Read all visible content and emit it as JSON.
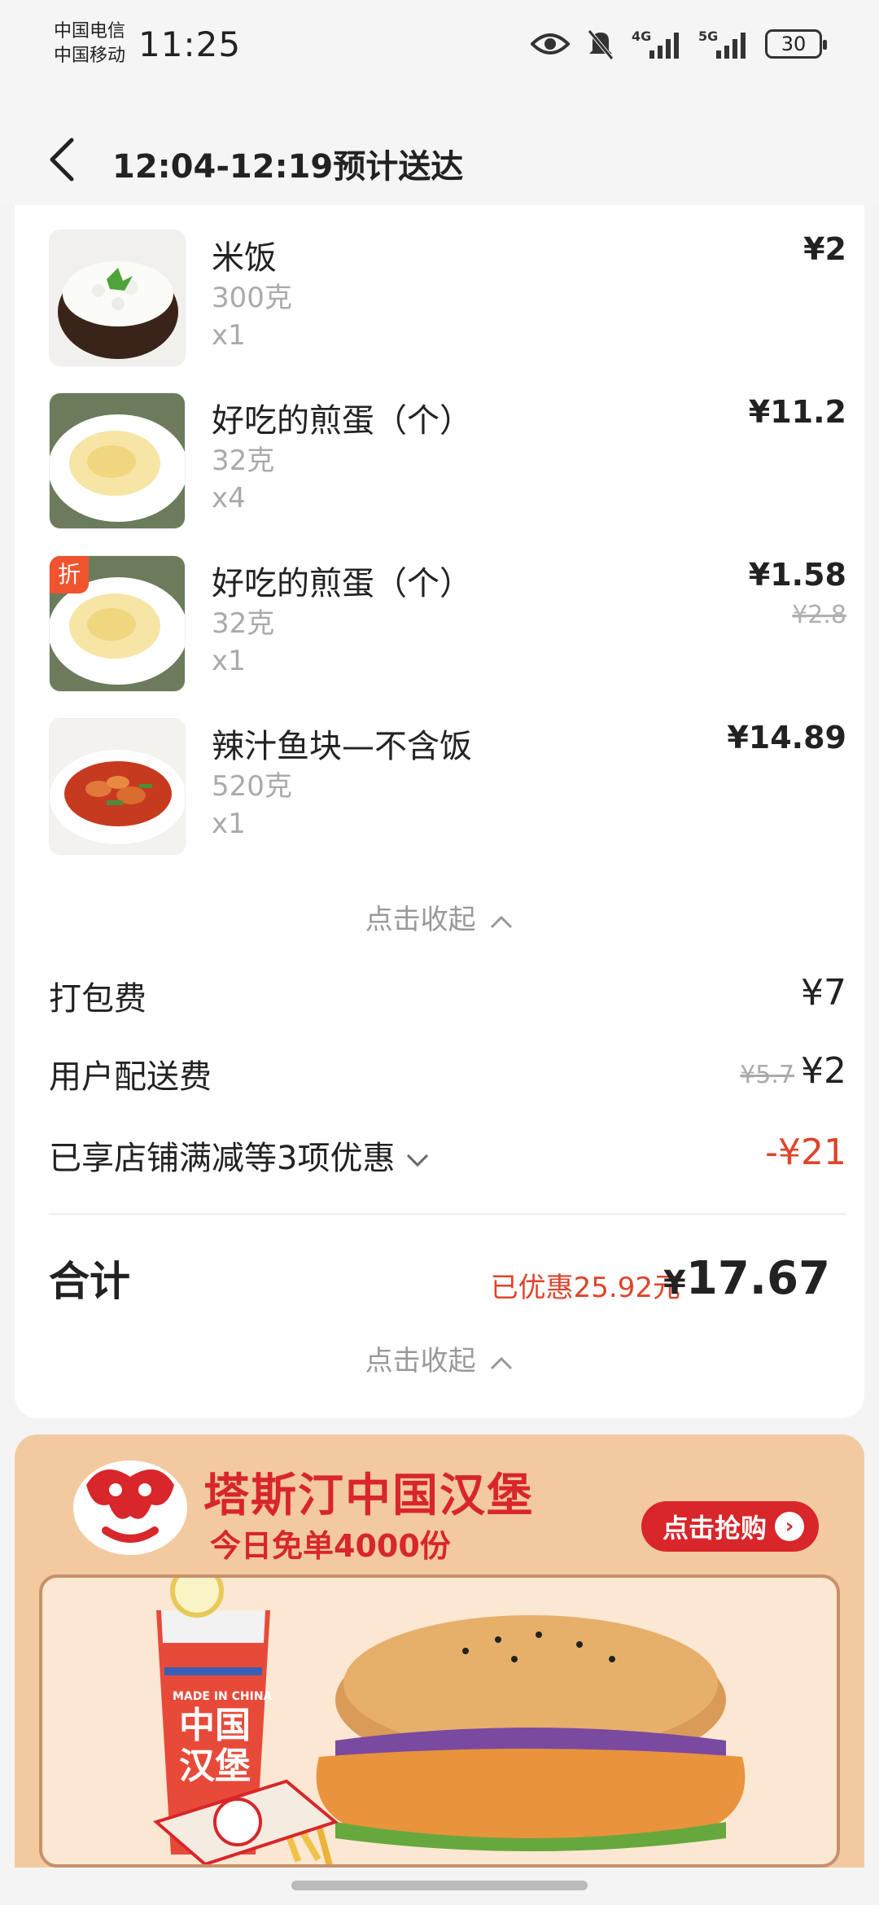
{
  "status_bar": {
    "carrier1": "中国电信",
    "carrier2": "中国移动",
    "time": "11:25",
    "network1": "4G",
    "network2": "5G",
    "battery": "30"
  },
  "header": {
    "title": "12:04-12:19预计送达"
  },
  "items": [
    {
      "name": "米饭",
      "weight": "300克",
      "qty": "x1",
      "price": "¥2",
      "original_price": "",
      "icon": "rice-bowl"
    },
    {
      "name": "好吃的煎蛋（个）",
      "weight": "32克",
      "qty": "x4",
      "price": "¥11.2",
      "original_price": "",
      "icon": "fried-egg"
    },
    {
      "name": "好吃的煎蛋（个）",
      "weight": "32克",
      "qty": "x1",
      "price": "¥1.58",
      "original_price": "¥2.8",
      "tag": "折",
      "icon": "fried-egg"
    },
    {
      "name": "辣汁鱼块—不含饭",
      "weight": "520克",
      "qty": "x1",
      "price": "¥14.89",
      "original_price": "",
      "icon": "spicy-fish"
    }
  ],
  "collapse_label": "点击收起",
  "fees": {
    "packing_label": "打包费",
    "packing_value": "¥7",
    "delivery_label": "用户配送费",
    "delivery_original": "¥5.7",
    "delivery_value": "¥2",
    "discount_label": "已享店铺满减等3项优惠",
    "discount_value": "-¥21"
  },
  "total": {
    "label": "合计",
    "saved": "已优惠25.92元",
    "currency": "¥",
    "amount": "17.67"
  },
  "banner": {
    "title": "塔斯汀中国汉堡",
    "subtitle": "今日免单4000份",
    "button": "点击抢购",
    "cup_text1": "中国",
    "cup_text2": "汉堡",
    "cup_small": "MADE IN CHINA"
  },
  "colors": {
    "accent_red": "#e0432b",
    "banner_bg": "#f3caa0",
    "brand_red": "#d8262a"
  }
}
